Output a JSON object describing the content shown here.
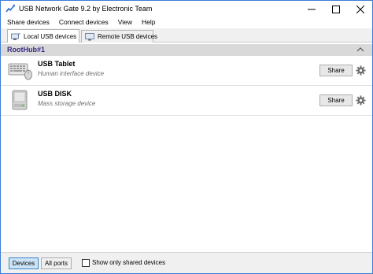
{
  "window": {
    "title": "USB Network Gate 9.2 by Electronic Team"
  },
  "menu": {
    "items": [
      "Share devices",
      "Connect devices",
      "View",
      "Help"
    ]
  },
  "tabs": [
    {
      "label": "Local USB devices",
      "icon": "usb-local-icon",
      "active": true
    },
    {
      "label": "Remote USB devices",
      "icon": "monitor-icon",
      "active": false
    }
  ],
  "group": {
    "title": "RootHub#1",
    "color": "#3a2a84"
  },
  "devices": [
    {
      "name": "USB Tablet",
      "description": "Human interface device",
      "icon": "keyboard-mouse-icon",
      "action": "Share"
    },
    {
      "name": "USB DISK",
      "description": "Mass storage device",
      "icon": "disk-drive-icon",
      "action": "Share"
    }
  ],
  "bottom": {
    "segments": [
      {
        "label": "Devices",
        "active": true
      },
      {
        "label": "All ports",
        "active": false
      }
    ],
    "checkbox_label": "Show only shared devices",
    "checkbox_checked": false
  },
  "colors": {
    "window_border": "#3c7fd6",
    "header_bg": "#d9d9d9",
    "active_segment": "#cce4f7"
  }
}
